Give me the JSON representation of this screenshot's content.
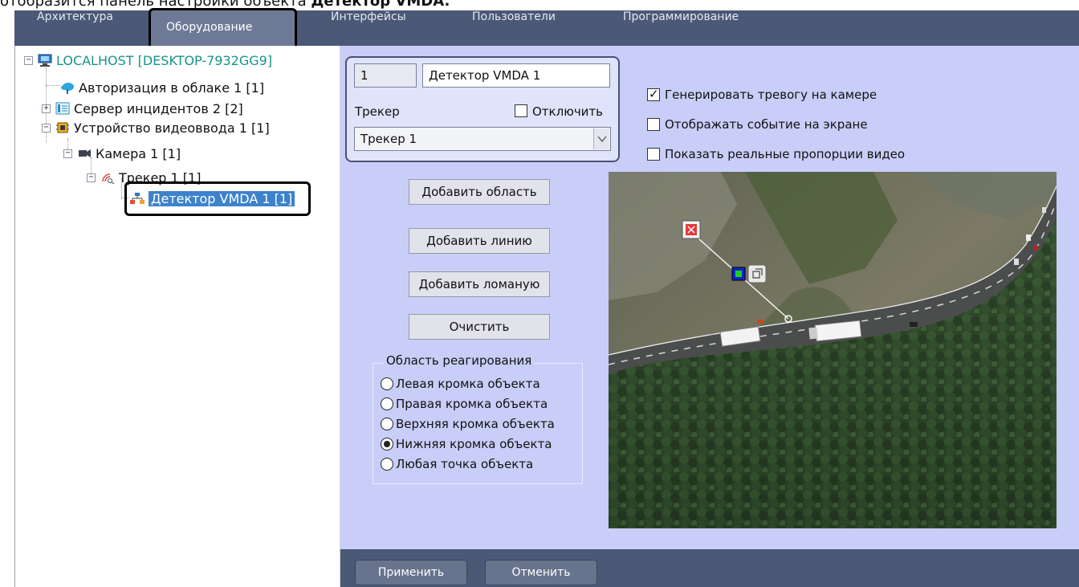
{
  "caption": {
    "text": "отобразится панель настройки объекта ",
    "bold": "Детектор VMDA."
  },
  "menu": {
    "items": [
      "Архитектура",
      "Оборудование",
      "Интерфейсы",
      "Пользователи",
      "Программирование"
    ],
    "active": "Оборудование"
  },
  "tree": {
    "items": [
      {
        "label": "LOCALHOST [DESKTOP-7932GG9]",
        "icon": "computer-icon",
        "toggle": "−",
        "color": "#16938c"
      },
      {
        "label": "Авторизация в облаке 1 [1]",
        "icon": "cloud-icon"
      },
      {
        "label": "Сервер инцидентов 2 [2]",
        "icon": "server-icon",
        "toggle": "+"
      },
      {
        "label": "Устройство видеоввода 1 [1]",
        "icon": "chip-icon",
        "toggle": "−"
      },
      {
        "label": "Камера 1 [1]",
        "icon": "camera-icon",
        "toggle": "−"
      },
      {
        "label": "Трекер 1 [1]",
        "icon": "tracker-icon",
        "toggle": "−"
      },
      {
        "label": "Детектор VMDA 1 [1]",
        "icon": "detector-icon",
        "selected": true
      }
    ]
  },
  "detector": {
    "id": "1",
    "name": "Детектор VMDA 1",
    "tracker_label": "Трекер",
    "disable_label": "Отключить",
    "disable_checked": false,
    "tracker_value": "Трекер 1"
  },
  "options": [
    {
      "label": "Генерировать тревогу на камере",
      "checked": true
    },
    {
      "label": "Отображать событие на экране",
      "checked": false
    },
    {
      "label": "Показать реальные пропорции видео",
      "checked": false
    }
  ],
  "buttons": {
    "add_area": "Добавить область",
    "add_line": "Добавить линию",
    "add_polyline": "Добавить ломаную",
    "clear": "Очистить",
    "apply": "Применить",
    "cancel": "Отменить"
  },
  "response_area": {
    "title": "Область реагирования",
    "options": [
      "Левая кромка объекта",
      "Правая кромка объекта",
      "Верхняя кромка объекта",
      "Нижняя кромка объекта",
      "Любая точка объекта"
    ],
    "selected": "Нижняя кромка объекта"
  },
  "colors": {
    "menubar": "#4b5876",
    "panel": "#c9cef8",
    "selection": "#3d82cc",
    "host_text": "#16938c"
  }
}
